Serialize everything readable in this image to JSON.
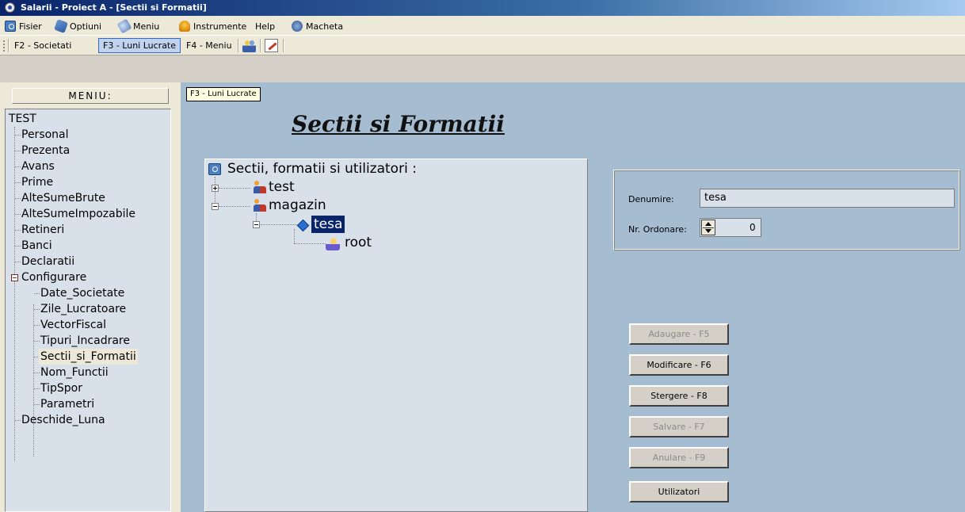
{
  "window": {
    "title": "Salarii - Proiect A - [Sectii si Formatii]"
  },
  "menubar": {
    "items": [
      {
        "label": "Fisier",
        "icon": "fisier-icon"
      },
      {
        "label": "Optiuni",
        "icon": "optiuni-icon"
      },
      {
        "label": "Meniu",
        "icon": "meniu-icon"
      },
      {
        "label": "Instrumente",
        "icon": "instrumente-icon"
      },
      {
        "label": "Help"
      },
      {
        "label": "Macheta",
        "icon": "macheta-icon"
      }
    ]
  },
  "toolbar": {
    "buttons": [
      {
        "label": "F2 - Societati",
        "active": false
      },
      {
        "label": "F3 - Luni Lucrate",
        "active": true
      },
      {
        "label": "F4 - Meniu",
        "active": false
      }
    ]
  },
  "left_menu": {
    "header": "MENIU:",
    "root": "TEST",
    "items": [
      "Personal",
      "Prezenta",
      "Avans",
      "Prime",
      "AlteSumeBrute",
      "AlteSumeImpozabile",
      "Retineri",
      "Banci",
      "Declaratii"
    ],
    "configurare": {
      "label": "Configurare",
      "children": [
        "Date_Societate",
        "Zile_Lucratoare",
        "VectorFiscal",
        "Tipuri_Incadrare",
        "Sectii_si_Formatii",
        "Nom_Functii",
        "TipSpor",
        "Parametri"
      ],
      "selected": "Sectii_si_Formatii"
    },
    "last": "Deschide_Luna"
  },
  "main": {
    "tooltip": "F3 - Luni Lucrate",
    "title": "Sectii si Formatii",
    "tree": {
      "root": "Sectii, formatii si utilizatori :",
      "nodes": [
        {
          "label": "test",
          "expanded": false
        },
        {
          "label": "magazin",
          "expanded": true,
          "children": [
            {
              "label": "tesa",
              "selected": true,
              "children": [
                {
                  "label": "root"
                }
              ]
            }
          ]
        }
      ]
    },
    "form": {
      "denumire_label": "Denumire:",
      "denumire_value": "tesa",
      "nr_label": "Nr. Ordonare:",
      "nr_value": "0"
    },
    "buttons": [
      {
        "label": "Adaugare - F5",
        "enabled": false
      },
      {
        "label": "Modificare - F6",
        "enabled": true
      },
      {
        "label": "Stergere  - F8",
        "enabled": true
      },
      {
        "label": "Salvare  - F7",
        "enabled": false
      },
      {
        "label": "Anulare  - F9",
        "enabled": false
      },
      {
        "label": "Utilizatori",
        "enabled": true
      }
    ]
  }
}
